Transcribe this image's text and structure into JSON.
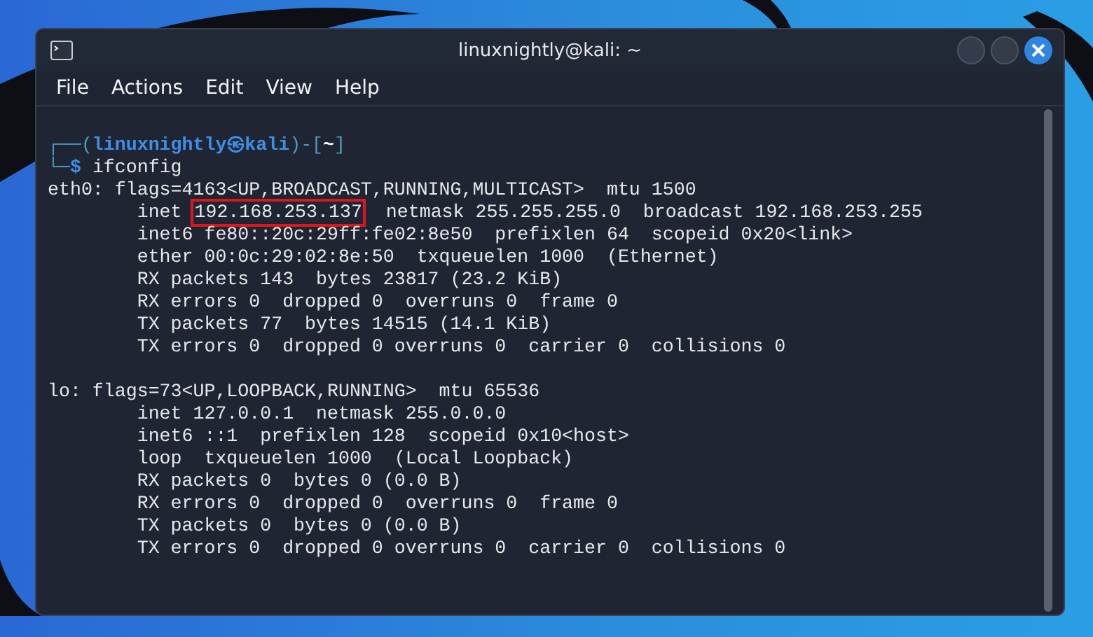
{
  "window": {
    "title": "linuxnightly@kali: ~"
  },
  "menu": [
    "File",
    "Actions",
    "Edit",
    "View",
    "Help"
  ],
  "prompt": [
    [
      {
        "text": "┌──(",
        "kind": "frame"
      },
      {
        "text": "linuxnightly㉿kali",
        "kind": "user"
      },
      {
        "text": ")-[",
        "kind": "frame"
      },
      {
        "text": "~",
        "kind": "path"
      },
      {
        "text": "]",
        "kind": "frame"
      }
    ],
    [
      {
        "text": "└─",
        "kind": "frame"
      },
      {
        "text": "$",
        "kind": "user"
      },
      {
        "text": "ifconfig",
        "kind": "command"
      }
    ]
  ],
  "interfaces": [
    [
      [
        {
          "text": "eth0: flags=4163<UP,BROADCAST,RUNNING,MULTICAST>  mtu 1500",
          "highlighted": false
        }
      ],
      [
        {
          "text": "        inet ",
          "highlighted": false
        },
        {
          "text": "192.168.253.137",
          "highlighted": true
        },
        {
          "text": "  netmask 255.255.255.0  broadcast 192.168.253.255",
          "highlighted": false
        }
      ],
      [
        {
          "text": "        inet6 fe80::20c:29ff:fe02:8e50  prefixlen 64  scopeid 0x20<link>",
          "highlighted": false
        }
      ],
      [
        {
          "text": "        ether 00:0c:29:02:8e:50  txqueuelen 1000  (Ethernet)",
          "highlighted": false
        }
      ],
      [
        {
          "text": "        RX packets 143  bytes 23817 (23.2 KiB)",
          "highlighted": false
        }
      ],
      [
        {
          "text": "        RX errors 0  dropped 0  overruns 0  frame 0",
          "highlighted": false
        }
      ],
      [
        {
          "text": "        TX packets 77  bytes 14515 (14.1 KiB)",
          "highlighted": false
        }
      ],
      [
        {
          "text": "        TX errors 0  dropped 0 overruns 0  carrier 0  collisions 0",
          "highlighted": false
        }
      ]
    ],
    [
      [
        {
          "text": "lo: flags=73<UP,LOOPBACK,RUNNING>  mtu 65536",
          "highlighted": false
        }
      ],
      [
        {
          "text": "        inet 127.0.0.1  netmask 255.0.0.0",
          "highlighted": false
        }
      ],
      [
        {
          "text": "        inet6 ::1  prefixlen 128  scopeid 0x10<host>",
          "highlighted": false
        }
      ],
      [
        {
          "text": "        loop  txqueuelen 1000  (Local Loopback)",
          "highlighted": false
        }
      ],
      [
        {
          "text": "        RX packets 0  bytes 0 (0.0 B)",
          "highlighted": false
        }
      ],
      [
        {
          "text": "        RX errors 0  dropped 0  overruns 0  frame 0",
          "highlighted": false
        }
      ],
      [
        {
          "text": "        TX packets 0  bytes 0 (0.0 B)",
          "highlighted": false
        }
      ],
      [
        {
          "text": "        TX errors 0  dropped 0 overruns 0  carrier 0  collisions 0",
          "highlighted": false
        }
      ]
    ]
  ]
}
